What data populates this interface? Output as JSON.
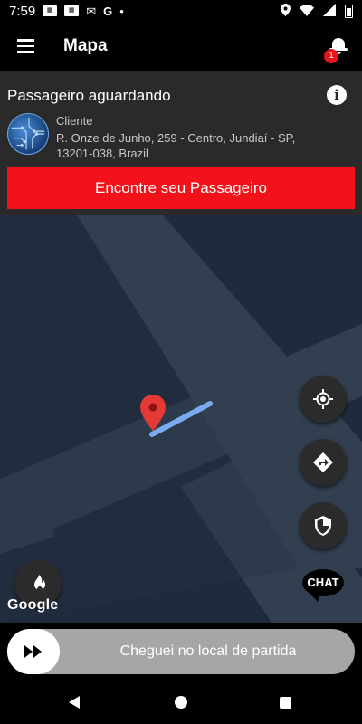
{
  "status_bar": {
    "time": "7:59",
    "notification_icons": [
      "news-icon",
      "news-icon",
      "mail-icon",
      "google-icon",
      "dot-icon"
    ],
    "system_icons": [
      "location-icon",
      "wifi-icon",
      "signal-icon",
      "battery-icon"
    ]
  },
  "app_bar": {
    "title": "Mapa",
    "notification_count": "1"
  },
  "trip_card": {
    "title": "Passageiro aguardando",
    "client_label": "Cliente",
    "address": "R. Onze de Junho, 259 - Centro, Jundiaí - SP, 13201-038, Brazil",
    "action_button": "Encontre seu Passageiro"
  },
  "map": {
    "attribution": "Google",
    "chat_label": "CHAT",
    "buttons": [
      "my-location-icon",
      "directions-icon",
      "shield-icon",
      "flame-icon"
    ]
  },
  "slider": {
    "label": "Cheguei no local de partida"
  },
  "colors": {
    "accent": "#f4121a",
    "map_background": "#1f2b3d",
    "card_background": "#2a2a2a",
    "route_line": "#7aaaf0",
    "pin": "#e53935"
  }
}
